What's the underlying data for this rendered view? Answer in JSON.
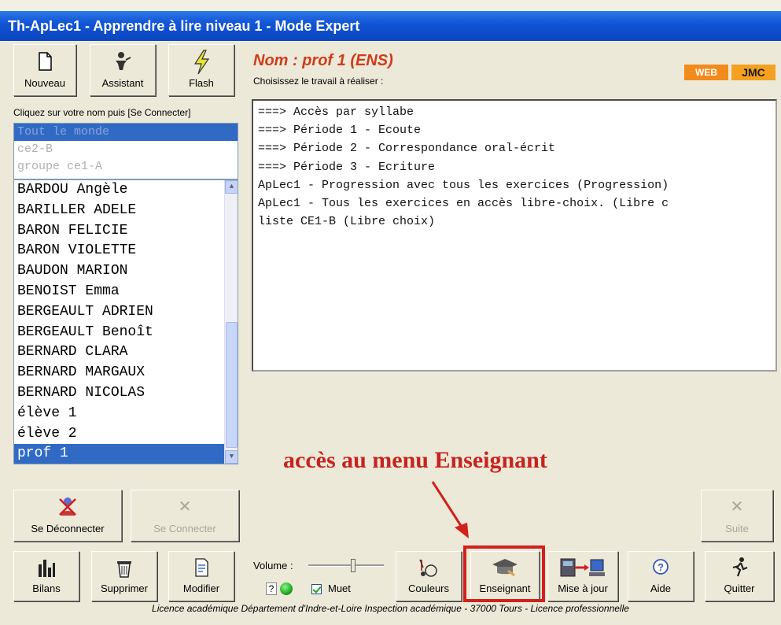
{
  "window": {
    "title": "Th-ApLec1 - Apprendre à lire niveau 1 - Mode Expert"
  },
  "toolbar_top": [
    {
      "label": "Nouveau",
      "icon": "new-document-icon"
    },
    {
      "label": "Assistant",
      "icon": "assistant-icon"
    },
    {
      "label": "Flash",
      "icon": "flash-icon"
    }
  ],
  "left_panel": {
    "instruction": "Cliquez sur votre nom puis [Se Connecter]",
    "groups": [
      "Tout le monde",
      "ce2-B",
      "groupe ce1-A"
    ],
    "names": [
      "BARDOU Angèle",
      "BARILLER ADELE",
      "BARON FELICIE",
      "BARON VIOLETTE",
      "BAUDON MARION",
      "BENOIST Emma",
      "BERGEAULT ADRIEN",
      "BERGEAULT Benoît",
      "BERNARD CLARA",
      "BERNARD MARGAUX",
      "BERNARD NICOLAS",
      "élève 1",
      "élève 2",
      "prof 1"
    ],
    "selected_name": "prof 1"
  },
  "header": {
    "nom": "Nom : prof 1 (ENS)",
    "choose": "Choisissez le travail à réaliser :",
    "web_logo": "WEB",
    "jmc_logo": "JMC"
  },
  "tasks": [
    "===> Accès par syllabe",
    "===> Période 1 - Ecoute",
    "===> Période 2 - Correspondance oral-écrit",
    "===> Période 3 - Ecriture",
    "ApLec1 - Progression avec tous les exercices (Progression)",
    "ApLec1 - Tous les exercices en accès libre-choix. (Libre c",
    "liste CE1-B (Libre choix)"
  ],
  "annotation": "accès au menu Enseignant",
  "connect_buttons": {
    "disconnect": "Se Déconnecter",
    "connect": "Se Connecter",
    "next": "Suite"
  },
  "bottom_buttons": [
    {
      "label": "Bilans",
      "icon": "bar-chart-icon"
    },
    {
      "label": "Supprimer",
      "icon": "trash-icon"
    },
    {
      "label": "Modifier",
      "icon": "edit-document-icon"
    },
    {
      "label": "Couleurs",
      "icon": "palette-icon"
    },
    {
      "label": "Enseignant",
      "icon": "graduation-cap-icon"
    },
    {
      "label": "Mise à jour",
      "icon": "update-computer-icon"
    },
    {
      "label": "Aide",
      "icon": "help-icon"
    },
    {
      "label": "Quitter",
      "icon": "running-man-icon"
    }
  ],
  "volume": {
    "label": "Volume :",
    "level_fraction": 0.6,
    "help": "?",
    "mute_label": "Muet",
    "mute_checked": true
  },
  "footer": "Licence académique Département d'Indre-et-Loire Inspection académique - 37000 Tours - Licence professionnelle",
  "colors": {
    "title_bar": "#1255d6",
    "accent_red": "#d2201c",
    "selection": "#316ac5",
    "nom_text": "#d13a1a"
  }
}
